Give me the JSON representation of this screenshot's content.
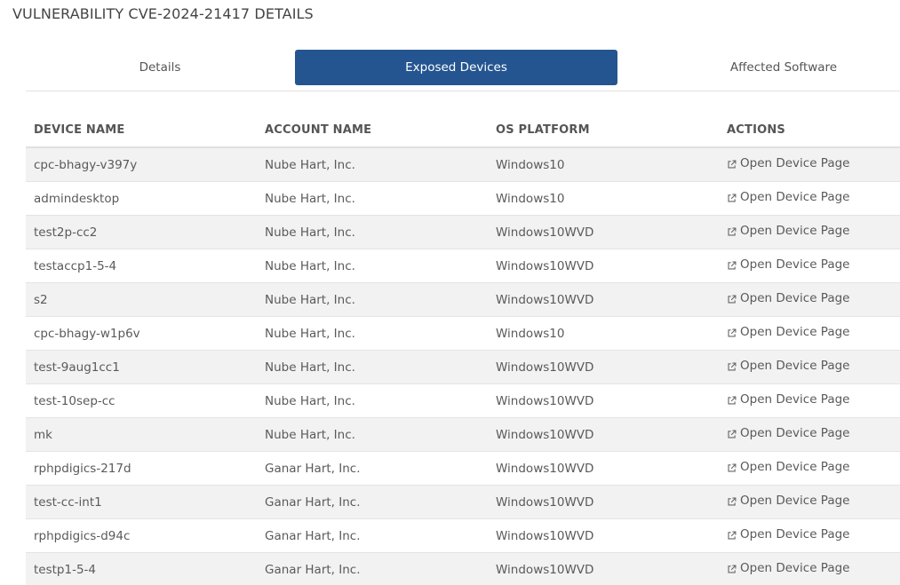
{
  "page": {
    "title": "VULNERABILITY CVE-2024-21417 DETAILS"
  },
  "tabs": [
    {
      "label": "Details",
      "active": false
    },
    {
      "label": "Exposed Devices",
      "active": true
    },
    {
      "label": "Affected Software",
      "active": false
    }
  ],
  "colors": {
    "active_tab": "#245590",
    "row_stripe": "#f2f2f2"
  },
  "table": {
    "columns": [
      "DEVICE NAME",
      "ACCOUNT NAME",
      "OS PLATFORM",
      "ACTIONS"
    ],
    "action_icon": "external-link-icon",
    "rows": [
      {
        "device": "cpc-bhagy-v397y",
        "account": "Nube Hart, Inc.",
        "os": "Windows10",
        "action": "Open Device Page"
      },
      {
        "device": "admindesktop",
        "account": "Nube Hart, Inc.",
        "os": "Windows10",
        "action": "Open Device Page"
      },
      {
        "device": "test2p-cc2",
        "account": "Nube Hart, Inc.",
        "os": "Windows10WVD",
        "action": "Open Device Page"
      },
      {
        "device": "testaccp1-5-4",
        "account": "Nube Hart, Inc.",
        "os": "Windows10WVD",
        "action": "Open Device Page"
      },
      {
        "device": "s2",
        "account": "Nube Hart, Inc.",
        "os": "Windows10WVD",
        "action": "Open Device Page"
      },
      {
        "device": "cpc-bhagy-w1p6v",
        "account": "Nube Hart, Inc.",
        "os": "Windows10",
        "action": "Open Device Page"
      },
      {
        "device": "test-9aug1cc1",
        "account": "Nube Hart, Inc.",
        "os": "Windows10WVD",
        "action": "Open Device Page"
      },
      {
        "device": "test-10sep-cc",
        "account": "Nube Hart, Inc.",
        "os": "Windows10WVD",
        "action": "Open Device Page"
      },
      {
        "device": "mk",
        "account": "Nube Hart, Inc.",
        "os": "Windows10WVD",
        "action": "Open Device Page"
      },
      {
        "device": "rphpdigics-217d",
        "account": "Ganar Hart, Inc.",
        "os": "Windows10WVD",
        "action": "Open Device Page"
      },
      {
        "device": "test-cc-int1",
        "account": "Ganar Hart, Inc.",
        "os": "Windows10WVD",
        "action": "Open Device Page"
      },
      {
        "device": "rphpdigics-d94c",
        "account": "Ganar Hart, Inc.",
        "os": "Windows10WVD",
        "action": "Open Device Page"
      },
      {
        "device": "testp1-5-4",
        "account": "Ganar Hart, Inc.",
        "os": "Windows10WVD",
        "action": "Open Device Page"
      }
    ]
  }
}
